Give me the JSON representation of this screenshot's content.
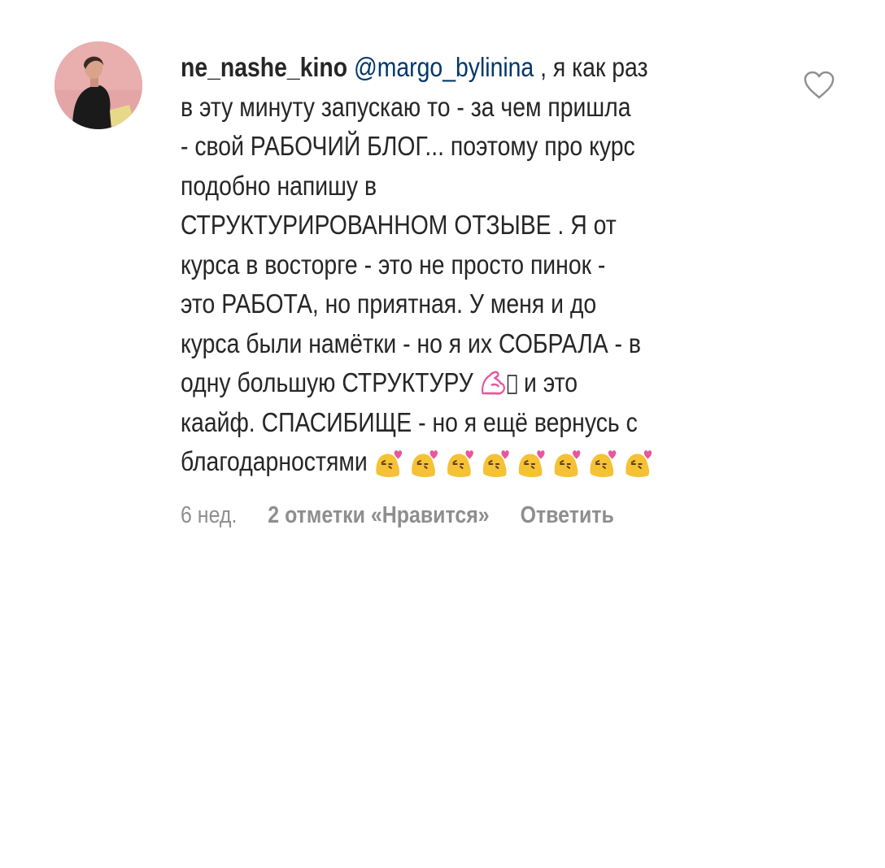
{
  "comment": {
    "username": "ne_nashe_kino",
    "mention": "@margo_bylinina",
    "lines": [
      " ,  я как раз",
      "в эту минуту запускаю  то - за чем пришла",
      "- свой РАБОЧИЙ БЛОГ... поэтому про курс",
      "подобно напишу в",
      "СТРУКТУРИРОВАННОМ ОТЗЫВЕ . Я от",
      "курса в восторге - это не просто пинок -",
      "это РАБОТА, но приятная. У меня и до",
      "курса были намётки - но я их СОБРАЛА - в",
      "одну большую СТРУКТУРУ ",
      " и это",
      "каайф. СПАСИБИЩЕ - но я ещё вернусь с",
      "благодарностями "
    ],
    "inline_emoji": [
      "flexed-biceps-icon",
      "missing-glyph-box"
    ],
    "trailing_emoji_icon": "kissing-heart-blob-icon",
    "trailing_emoji_count": 8,
    "time": "6 нед.",
    "likes_label": "2 отметки «Нравится»",
    "reply_label": "Ответить",
    "like_icon": "heart-outline-icon"
  },
  "colors": {
    "text": "#262626",
    "mention": "#00376b",
    "meta": "#8e8e8e",
    "avatar_bg": "#e4a3a3",
    "emoji_yellow": "#f5c233",
    "emoji_pink": "#e8569b"
  }
}
